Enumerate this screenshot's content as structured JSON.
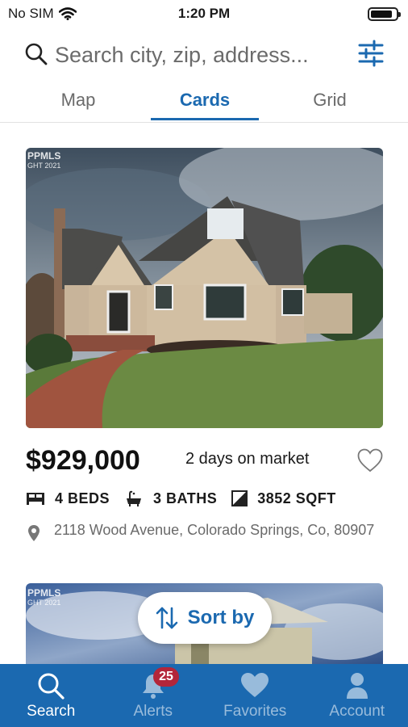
{
  "status_bar": {
    "carrier": "No SIM",
    "time": "1:20 PM",
    "battery_level": 0.85
  },
  "search": {
    "placeholder": "Search city, zip, address..."
  },
  "tabs": [
    {
      "label": "Map",
      "active": false
    },
    {
      "label": "Cards",
      "active": true
    },
    {
      "label": "Grid",
      "active": false
    }
  ],
  "listings": [
    {
      "watermark": "PPMLS",
      "watermark_sub": "GHT 2021",
      "price": "$929,000",
      "days_on_market": "2 days on market",
      "beds": "4 BEDS",
      "baths": "3 BATHS",
      "sqft": "3852 SQFT",
      "address": "2118 Wood Avenue, Colorado Springs, Co, 80907"
    },
    {
      "watermark": "PPMLS",
      "watermark_sub": "GHT 2021"
    }
  ],
  "sort_button": {
    "label": "Sort by"
  },
  "bottom_nav": [
    {
      "label": "Search",
      "icon": "search-icon",
      "active": true
    },
    {
      "label": "Alerts",
      "icon": "bell-icon",
      "active": false,
      "badge": "25"
    },
    {
      "label": "Favorites",
      "icon": "heart-icon",
      "active": false
    },
    {
      "label": "Account",
      "icon": "person-icon",
      "active": false
    }
  ],
  "colors": {
    "accent": "#1b69b0",
    "badge": "#b3263a"
  }
}
